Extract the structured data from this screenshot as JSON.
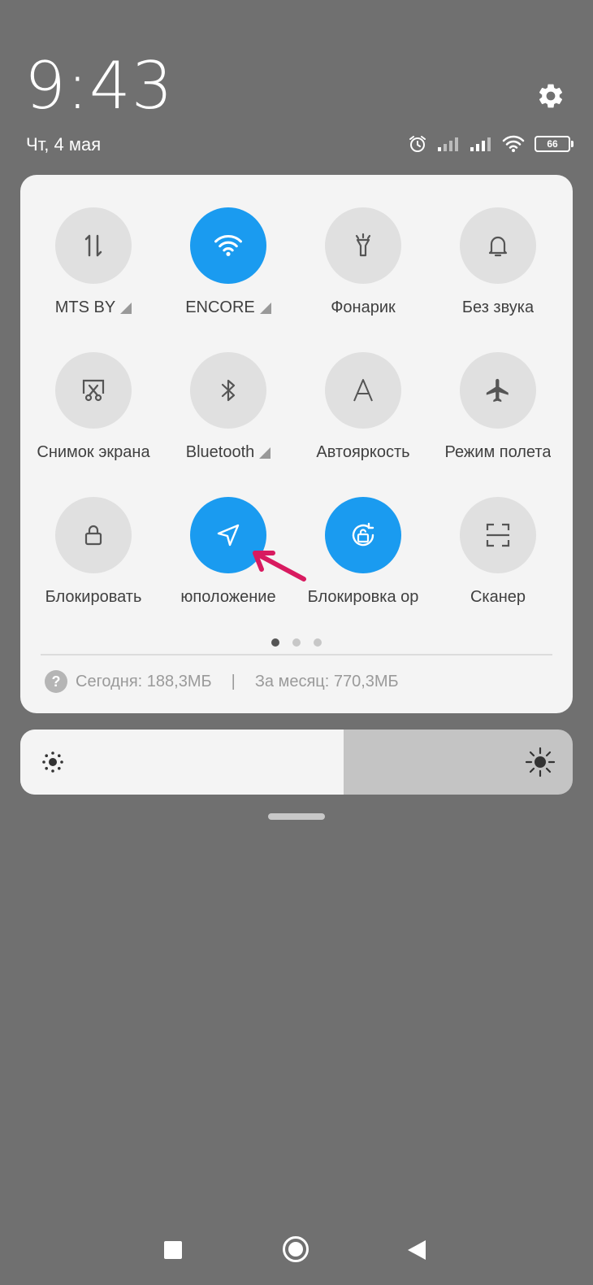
{
  "status": {
    "time": "9:43",
    "date": "Чт, 4 мая",
    "battery": "66"
  },
  "tiles": [
    {
      "label": "MTS BY",
      "icon": "mobile-data-icon",
      "active": false,
      "has_arrow": true
    },
    {
      "label": "ENCORE",
      "icon": "wifi-icon",
      "active": true,
      "has_arrow": true
    },
    {
      "label": "Фонарик",
      "icon": "flashlight-icon",
      "active": false,
      "has_arrow": false
    },
    {
      "label": "Без звука",
      "icon": "bell-icon",
      "active": false,
      "has_arrow": false
    },
    {
      "label": "Снимок экрана",
      "icon": "screenshot-icon",
      "active": false,
      "has_arrow": false
    },
    {
      "label": "Bluetooth",
      "icon": "bluetooth-icon",
      "active": false,
      "has_arrow": true
    },
    {
      "label": "Автояркость",
      "icon": "auto-brightness-icon",
      "active": false,
      "has_arrow": false
    },
    {
      "label": "Режим полета",
      "icon": "airplane-icon",
      "active": false,
      "has_arrow": false
    },
    {
      "label": "Блокировать",
      "icon": "lock-icon",
      "active": false,
      "has_arrow": false
    },
    {
      "label": "юположение",
      "icon": "location-icon",
      "active": true,
      "has_arrow": false
    },
    {
      "label": "Блокировка ор",
      "icon": "rotation-lock-icon",
      "active": true,
      "has_arrow": false
    },
    {
      "label": "Сканер",
      "icon": "scanner-icon",
      "active": false,
      "has_arrow": false
    }
  ],
  "pager": {
    "pages": 3,
    "current": 1
  },
  "usage": {
    "today": "Сегодня: 188,3МБ",
    "separator": "|",
    "month": "За месяц: 770,3МБ"
  },
  "brightness": {
    "level": 0.585
  },
  "colors": {
    "accent": "#1a9bf0",
    "annotation": "#d81b60",
    "background": "#707070"
  }
}
